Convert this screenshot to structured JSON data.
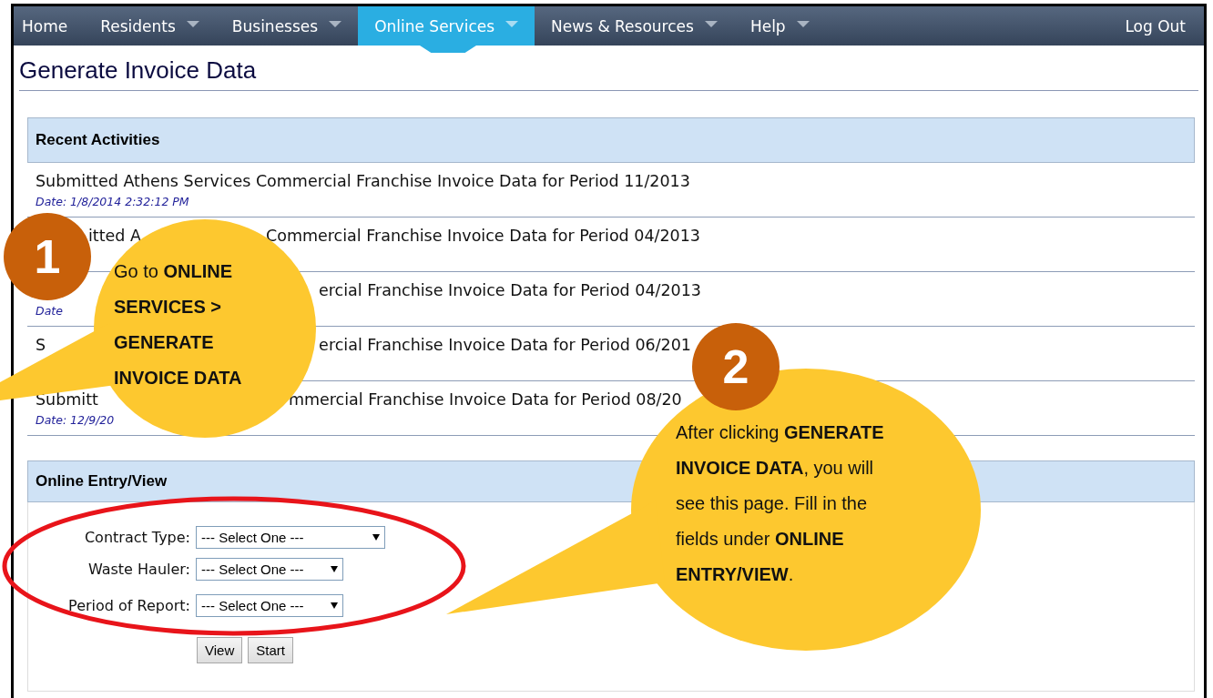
{
  "nav": {
    "items": [
      {
        "label": "Home",
        "dropdown": false,
        "selected": false
      },
      {
        "label": "Residents",
        "dropdown": true,
        "selected": false
      },
      {
        "label": "Businesses",
        "dropdown": true,
        "selected": false
      },
      {
        "label": "Online Services",
        "dropdown": true,
        "selected": true
      },
      {
        "label": "News & Resources",
        "dropdown": true,
        "selected": false
      },
      {
        "label": "Help",
        "dropdown": true,
        "selected": false
      }
    ],
    "logout": "Log Out"
  },
  "title": "Generate Invoice Data",
  "recent": {
    "heading": "Recent Activities",
    "rows": [
      {
        "parts": [
          "Submitted Athens Services Commercial Franchise Invoice Data for Period 11/2013"
        ],
        "date": "Date: 1/8/2014 2:32:12 PM"
      },
      {
        "parts": [
          "itted A",
          "Commercial Franchise Invoice Data for Period 04/2013"
        ]
      },
      {
        "parts": [
          "ercial Franchise Invoice Data for Period 04/2013"
        ],
        "date": "Date"
      },
      {
        "parts": [
          "S",
          "ercial Franchise Invoice Data for Period 06/201"
        ]
      },
      {
        "parts": [
          "Submitt",
          "mmercial Franchise Invoice Data for Period 08/20"
        ],
        "date": "Date: 12/9/20"
      }
    ]
  },
  "entry": {
    "heading": "Online Entry/View",
    "fields": [
      {
        "label": "Contract Type:",
        "value": "--- Select One ---"
      },
      {
        "label": "Waste Hauler:",
        "value": "--- Select One ---"
      },
      {
        "label": "Period of Report:",
        "value": "--- Select One ---"
      }
    ],
    "buttons": [
      "View",
      "Start"
    ]
  },
  "callouts": [
    {
      "number": "1",
      "text": "Go to **ONLINE SERVICES > GENERATE INVOICE DATA**"
    },
    {
      "number": "2",
      "text": "After clicking **GENERATE INVOICE DATA**, you will see this page. Fill in the fields under **ONLINE ENTRY/VIEW**."
    }
  ]
}
